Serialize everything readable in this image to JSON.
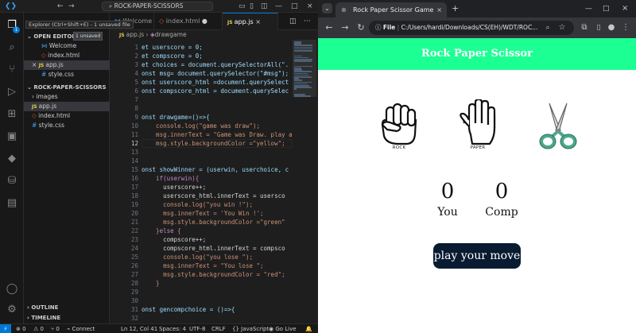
{
  "vscode": {
    "title": "ROCK-PAPER-SCISSORS",
    "tooltip": "Explorer (Ctrl+Shift+E) - 1 unsaved file",
    "unsaved_badge": "1 unsaved",
    "activity_badge": "1",
    "explorer": {
      "open_editors_label": "OPEN EDITORS",
      "open_editors": [
        {
          "icon": "vscode-icon",
          "name": "Welcome"
        },
        {
          "icon": "html-icon",
          "name": "index.html"
        },
        {
          "icon": "js-icon",
          "name": "app.js",
          "prefix": "×"
        },
        {
          "icon": "css-icon",
          "name": "style.css"
        }
      ],
      "folder_label": "ROCK-PAPER-SCISSORS",
      "files": [
        {
          "icon": "folder-icon",
          "name": "images"
        },
        {
          "icon": "js-icon",
          "name": "app.js"
        },
        {
          "icon": "html-icon",
          "name": "index.html"
        },
        {
          "icon": "css-icon",
          "name": "style.css"
        }
      ],
      "outline_label": "OUTLINE",
      "timeline_label": "TIMELINE"
    },
    "tabs": [
      {
        "name": "Welcome"
      },
      {
        "name": "index.html"
      },
      {
        "name": "app.js",
        "close": "×"
      }
    ],
    "breadcrumb": {
      "file": "app.js",
      "symbol": "drawgame"
    },
    "lines": [
      "1",
      "2",
      "3",
      "4",
      "5",
      "6",
      "7",
      "8",
      "9",
      "10",
      "11",
      "12",
      "13",
      "14",
      "15",
      "16",
      "17",
      "18",
      "19",
      "20",
      "21",
      "22",
      "23",
      "24",
      "25",
      "26",
      "27",
      "28",
      "29",
      "30",
      "31",
      "32"
    ],
    "code": [
      "et userscore = 0;",
      "et compscore = 0;",
      "et choices = document.querySelectorAll(\".",
      "onst msg= document.querySelector(\"#msg\");",
      "onst userscore_html =document.querySelect",
      "onst compscore_html = document.querySelec",
      "",
      "",
      "onst drawgame=()=>{",
      "    console.log(\"game was draw\");",
      "    msg.innerText = \"Game was Draw. play a",
      "    msg.style.backgroundColor =\"yellow\";",
      "",
      "",
      "onst showWinner = (userwin, userchoice, c",
      "    if(userwin){",
      "      userscore++;",
      "      userscore_html.innerText = usersco",
      "      console.log(\"you win !\");",
      "      msg.innerText = 'You Win !';",
      "      msg.style.backgroundColor =\"green\"",
      "    }else {",
      "      compscore++;",
      "      compscore_html.innerText = compsco",
      "      console.log(\"you lose \");",
      "      msg.innerText = \"You lose \";",
      "      msg.style.backgroundColor = \"red\";",
      "    }",
      "",
      "",
      "onst gencompchoice = ()=>{",
      "      const option =[\"rock\",\"paper\",\"s"
    ],
    "status": {
      "remote": "⚡",
      "errors": "⊗ 0",
      "warnings": "⚠ 0",
      "ports": "⑂ 0",
      "connect": "Connect",
      "position": "Ln 12, Col 41",
      "spaces": "Spaces: 4",
      "encoding": "UTF-8",
      "eol": "CRLF",
      "language": "{} JavaScript",
      "golive": "Go Live",
      "bell": "🔔"
    }
  },
  "browser": {
    "tab_title": "Rock Paper Scissor Game",
    "tab_close": "×",
    "new_tab": "+",
    "window_controls": [
      "—",
      "□",
      "×"
    ],
    "url_chip": "File",
    "url": "C:/Users/hardi/Downloads/CS(EH)/WDT/ROC...",
    "page": {
      "heading": "Rock Paper Scissor",
      "choices": [
        {
          "id": "rock",
          "label": "ROCK"
        },
        {
          "id": "paper",
          "label": "PAPER"
        },
        {
          "id": "scissors",
          "label": ""
        }
      ],
      "user_score": "0",
      "user_label": "You",
      "comp_score": "0",
      "comp_label": "Comp",
      "message": "play your move"
    }
  },
  "colors": {
    "header_green": "#1cff93",
    "message_bg": "#081b31",
    "vscode_bg": "#1e1e1e",
    "accent_blue": "#0078d4"
  }
}
